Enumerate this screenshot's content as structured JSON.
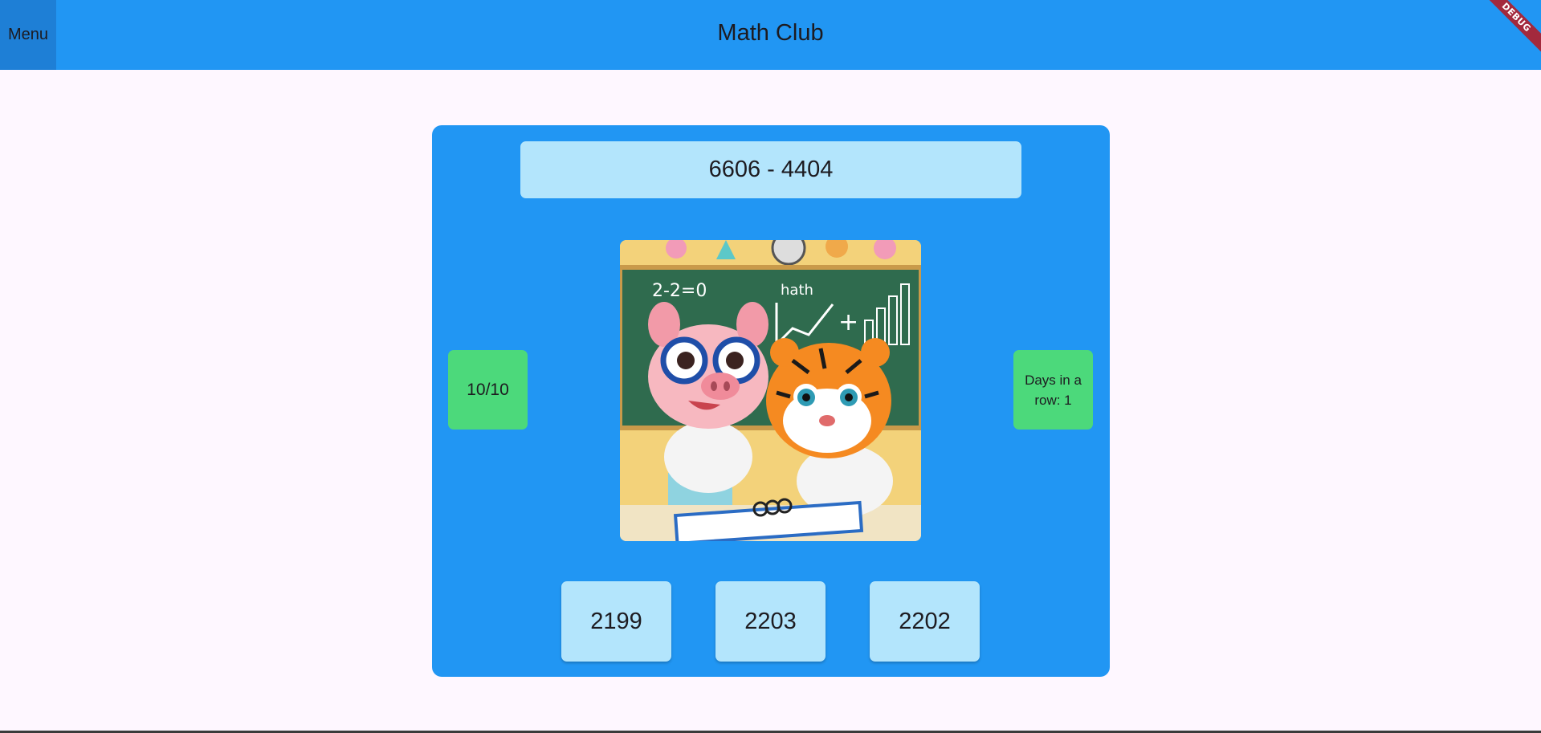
{
  "app": {
    "title": "Math Club",
    "menu_label": "Menu",
    "debug_label": "DEBUG"
  },
  "quiz": {
    "question": "6606 - 4404",
    "score": "10/10",
    "streak": "Days in a row: 1",
    "answers": [
      "2199",
      "2203",
      "2202"
    ]
  },
  "illustration": {
    "board_text": "hath",
    "board_equation": "2-2=0",
    "description_icon": "pig-and-tiger-math-class-illustration"
  },
  "colors": {
    "primary": "#2196f3",
    "answer_bg": "#b3e5fc",
    "stat_bg": "#4cd97b",
    "page_bg": "#fef7ff"
  }
}
